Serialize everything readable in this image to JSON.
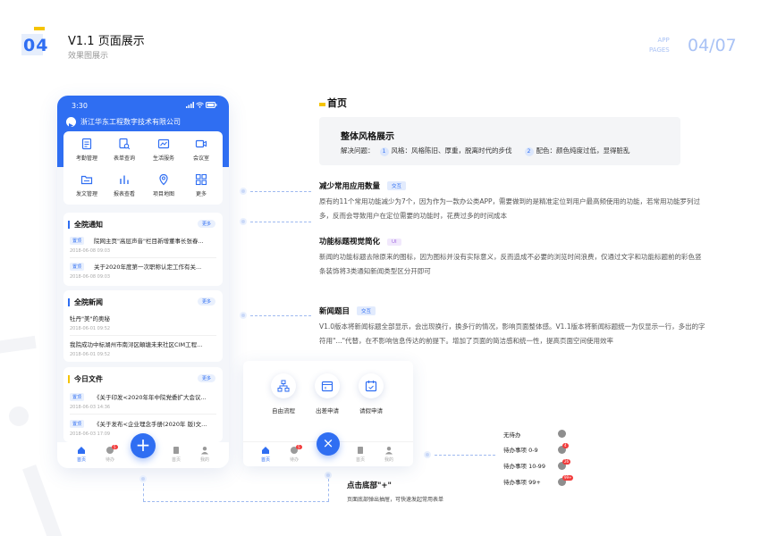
{
  "header": {
    "num": "04",
    "title": "V1.1 页面展示",
    "subtitle": "效果图展示",
    "app_label": "APP",
    "pages_label": "PAGES",
    "page_indicator": "04/07"
  },
  "phone": {
    "time": "3:30",
    "company": "浙江华东工程数字技术有限公司",
    "apps": [
      {
        "label": "考勤管理",
        "icon": "attendance-icon"
      },
      {
        "label": "表单查询",
        "icon": "form-search-icon"
      },
      {
        "label": "生活服务",
        "icon": "life-service-icon"
      },
      {
        "label": "会议室",
        "icon": "meeting-room-icon"
      },
      {
        "label": "发文管理",
        "icon": "document-folder-icon"
      },
      {
        "label": "报表查看",
        "icon": "report-chart-icon"
      },
      {
        "label": "项目地图",
        "icon": "map-pin-icon"
      },
      {
        "label": "更多",
        "icon": "grid-more-icon"
      }
    ],
    "notice": {
      "title": "全院通知",
      "more": "更多",
      "items": [
        {
          "tag": "置顶",
          "text": "院网主页\"高层声音\"栏目新增董事长张春...",
          "date": "2018-06-08   09:03"
        },
        {
          "tag": "置顶",
          "text": "关于2020年度第一次职称认定工作有关...",
          "date": "2018-06-08   09:03"
        }
      ]
    },
    "news": {
      "title": "全院新闻",
      "more": "更多",
      "items": [
        {
          "text": "牡丹\"美\"的奥秘",
          "date": "2018-06-01      09:52"
        },
        {
          "text": "我院成功中标湖州市南浔区頔塘未来社区CIM工程...",
          "date": "2018-06-01      09:52"
        }
      ]
    },
    "files": {
      "title": "今日文件",
      "more": "更多",
      "items": [
        {
          "tag": "置顶",
          "text": "《关于印发<2020年年中院党委扩大会议...",
          "date": "2018-06-03   14:36"
        },
        {
          "tag": "置顶",
          "text": "《关于发布<企业理念手册(2020年 版)文...",
          "date": "2018-06-03   17:09"
        }
      ]
    },
    "tabs": [
      {
        "label": "首页",
        "icon": "home-icon",
        "active": true
      },
      {
        "label": "待办",
        "icon": "todo-icon",
        "badge": "5"
      },
      {
        "label": "首页",
        "icon": "document-icon"
      },
      {
        "label": "我的",
        "icon": "user-icon"
      }
    ],
    "plus": "+"
  },
  "right": {
    "home_title": "首页",
    "card_title": "整体风格展示",
    "card_problem_label": "解决问题：",
    "card_points": [
      {
        "num": "1",
        "text": "风格：风格陈旧、厚重，脱离时代的步伐"
      },
      {
        "num": "2",
        "text": "配色：颜色纯度过低，显得脏乱"
      }
    ],
    "features": [
      {
        "title": "减少常用应用数量",
        "tag": "交互",
        "desc": "原有的11个常用功能减少为7个，因为作为一款办公类APP，需要做到的是精准定位到用户最高频使用的功能，若常用功能罗列过多，反而会导致用户在定位需要的功能时，花费过多的时间成本"
      },
      {
        "title": "功能标题视觉简化",
        "tag": "UI",
        "desc": "新闻的功能标题去除原来的图标，因为图标并没有实际意义，反而造成不必要的浏览时间浪费，仅通过文字和功能标题前的彩色竖条装饰将3类通知新闻类型区分开即可"
      },
      {
        "title": "新闻题目",
        "tag": "交互",
        "desc": "V1.0版本将新闻标题全部显示，会出现换行，换多行的情况，影响页面整体感。V1.1版本将新闻标题统一为仅显示一行，多出的字符用\"...\"代替，在不影响信息传达的前提下。增加了页面的简洁感和统一性，提高页面空间使用效率"
      }
    ]
  },
  "popup": {
    "items": [
      {
        "label": "自由流程",
        "icon": "flow-chart-icon"
      },
      {
        "label": "出差申请",
        "icon": "trip-calendar-icon"
      },
      {
        "label": "请假申请",
        "icon": "leave-calendar-icon"
      }
    ],
    "tabs": [
      {
        "label": "首页",
        "active": true
      },
      {
        "label": "待办",
        "badge": "5"
      },
      {
        "label": "首页"
      },
      {
        "label": "我的"
      }
    ],
    "close": "×"
  },
  "bottom": {
    "title": "点击底部\"+\"",
    "desc": "页面底部弹出抽屉，可快速发起常用表单"
  },
  "legend": [
    {
      "label": "无待办"
    },
    {
      "label": "待办事项  0-9",
      "badge": "4"
    },
    {
      "label": "待办事项  10-99",
      "badge": "26"
    },
    {
      "label": "待办事项  99+",
      "badge": "99+"
    }
  ],
  "colors": {
    "primary": "#2f6ef2",
    "accent_yellow": "#f5c400",
    "badge_red": "#f23c3c"
  }
}
